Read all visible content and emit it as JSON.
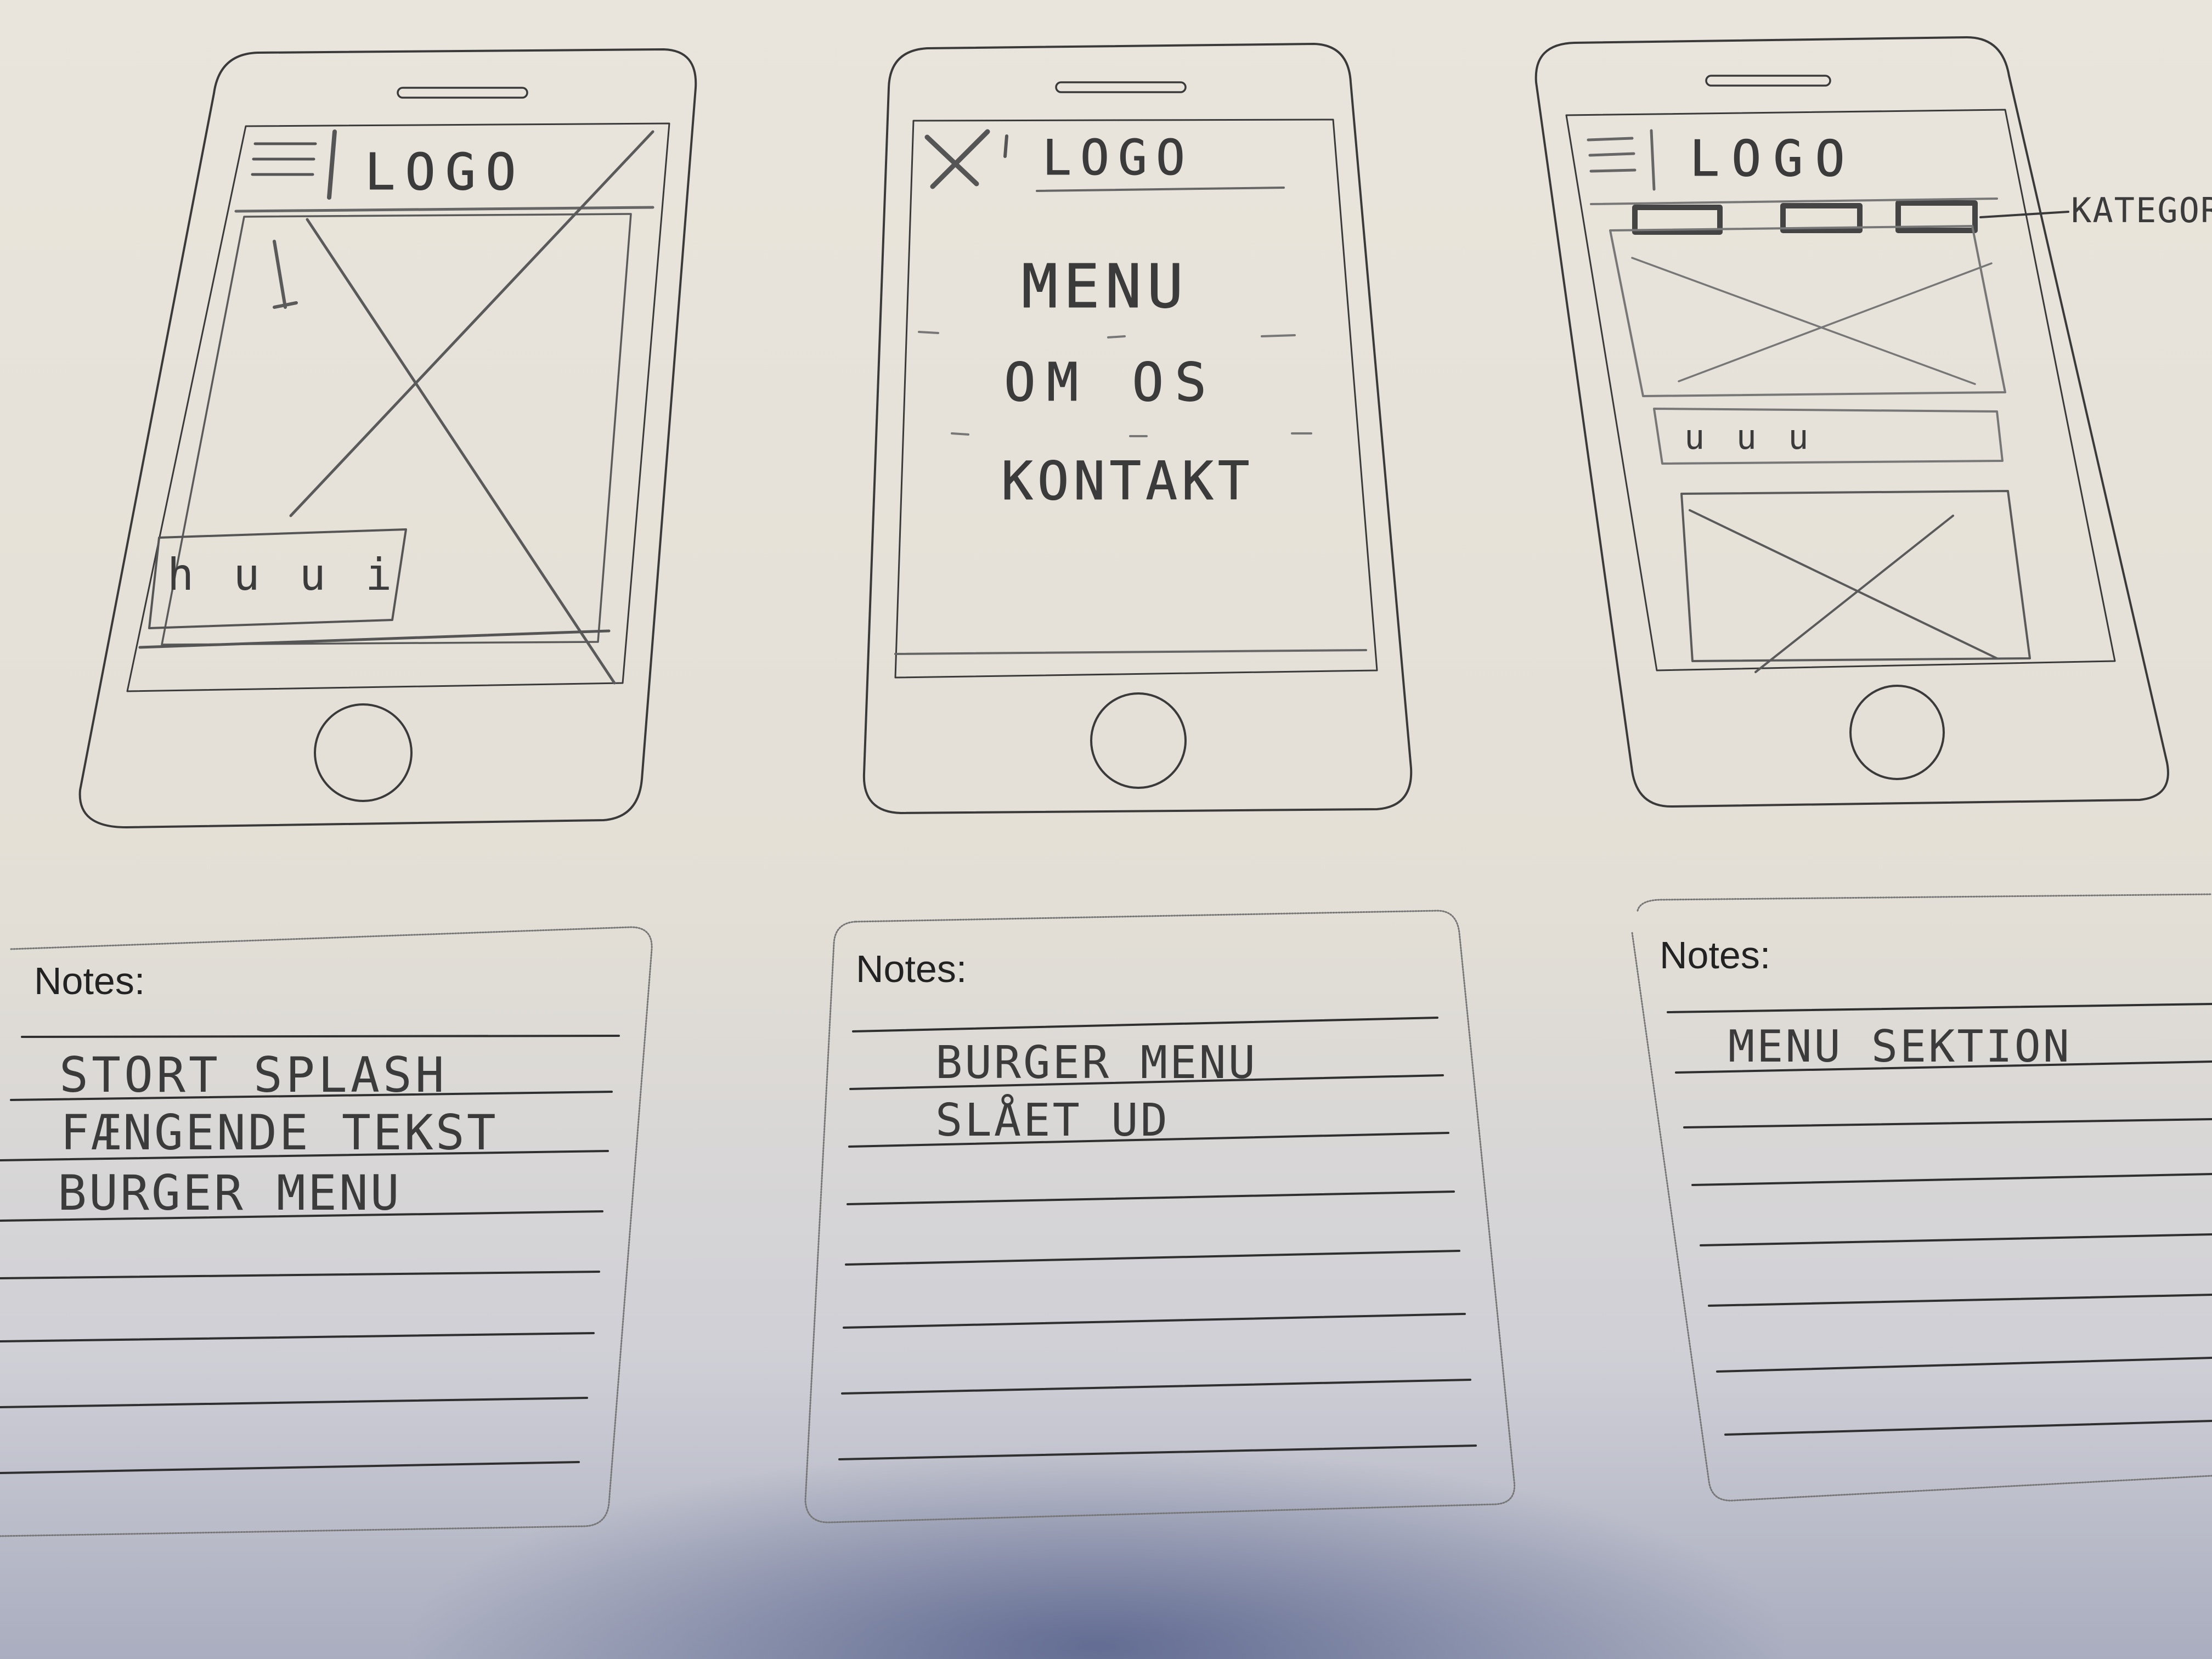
{
  "sketches": [
    {
      "logo": "LOGO",
      "menu_button": "hamburger-icon",
      "hero_caption": "h u u i"
    },
    {
      "close_button": "X",
      "logo": "LOGO",
      "menu_items": [
        "MENU",
        "OM OS",
        "KONTAKT"
      ]
    },
    {
      "menu_button": "hamburger-icon",
      "logo": "LOGO",
      "category_annotation": "KATEGOR",
      "list_caption": "u u u"
    }
  ],
  "notes": [
    {
      "title": "Notes:",
      "lines": [
        "STORT   SPLASH",
        "FÆNGENDE  TEKST",
        "BURGER  MENU"
      ]
    },
    {
      "title": "Notes:",
      "lines": [
        "BURGER   MENU",
        "SLÅET  UD"
      ]
    },
    {
      "title": "Notes:",
      "lines": [
        "MENU   SEKTION"
      ]
    }
  ]
}
